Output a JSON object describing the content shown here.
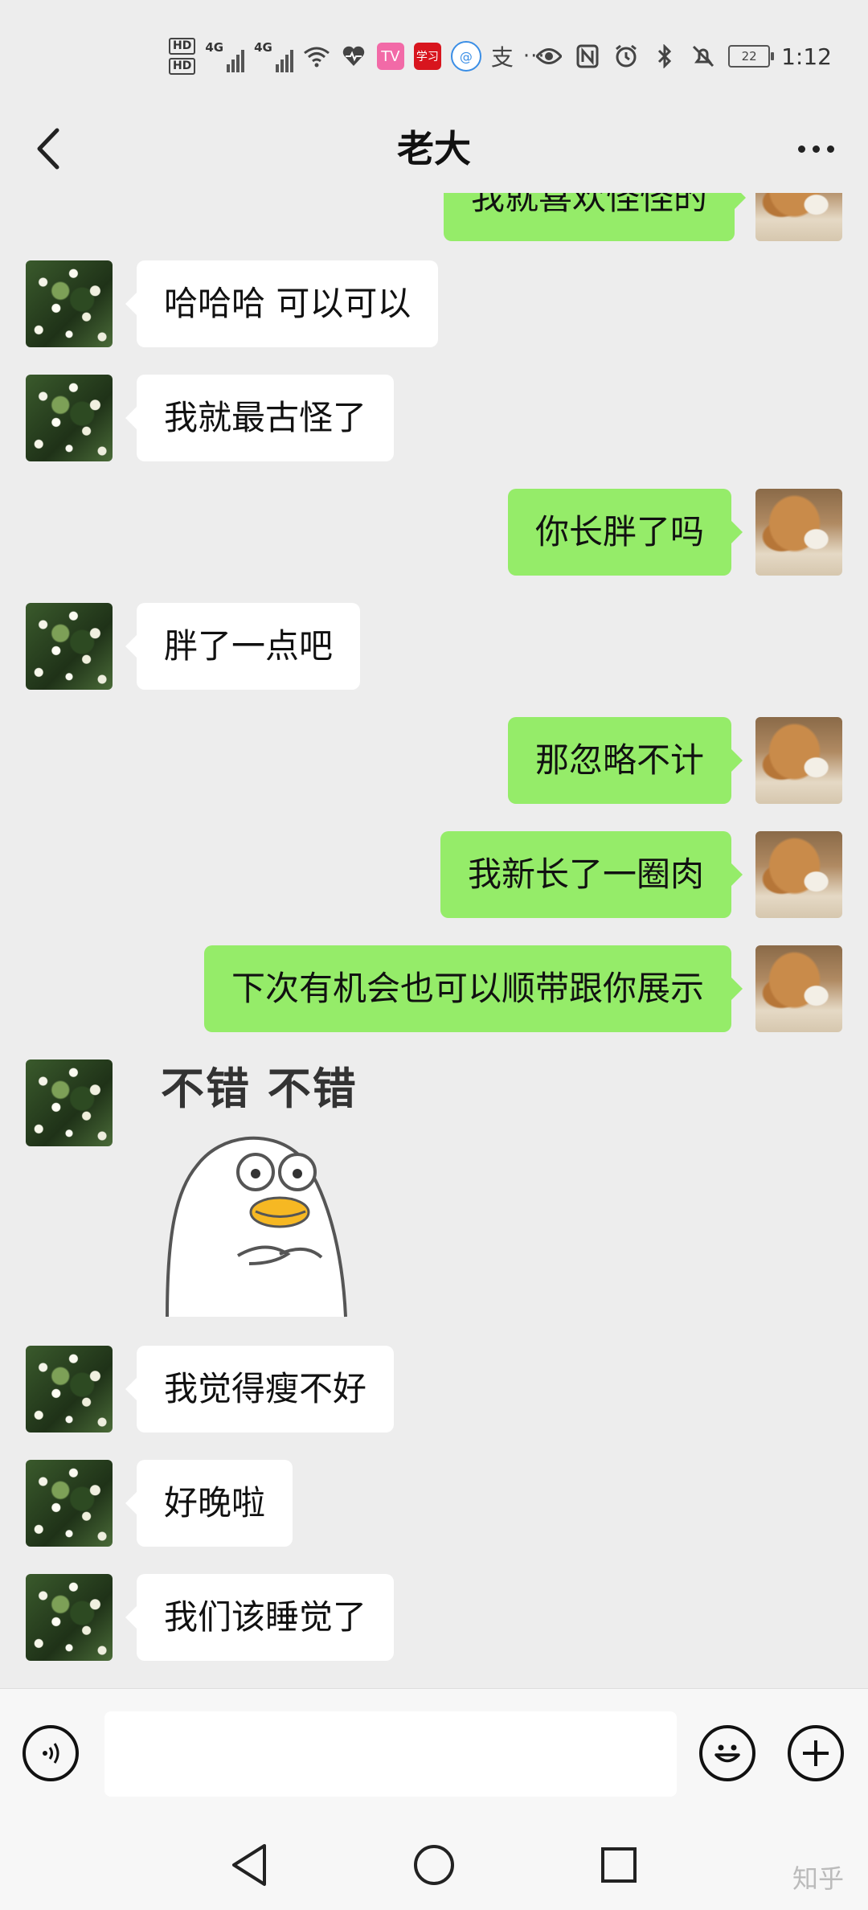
{
  "status_bar": {
    "sim1": "HD",
    "sim2": "HD",
    "net1": "4G",
    "net2": "4G",
    "app1": "TV",
    "app2": "学习",
    "app3": "@",
    "zhi": "支",
    "more": "···",
    "battery": "22",
    "time": "1:12"
  },
  "header": {
    "title": "老大"
  },
  "messages": [
    {
      "side": "right",
      "text": "我就喜欢怪怪的"
    },
    {
      "side": "left",
      "text": "哈哈哈 可以可以"
    },
    {
      "side": "left",
      "text": "我就最古怪了"
    },
    {
      "side": "right",
      "text": "你长胖了吗"
    },
    {
      "side": "left",
      "text": "胖了一点吧"
    },
    {
      "side": "right",
      "text": "那忽略不计"
    },
    {
      "side": "right",
      "text": "我新长了一圈肉"
    },
    {
      "side": "right",
      "text": "下次有机会也可以顺带跟你展示"
    },
    {
      "side": "left",
      "type": "sticker",
      "text": "不错 不错"
    },
    {
      "side": "left",
      "text": "我觉得瘦不好"
    },
    {
      "side": "left",
      "text": "好晚啦"
    },
    {
      "side": "left",
      "text": "我们该睡觉了"
    }
  ],
  "watermark": "知乎"
}
